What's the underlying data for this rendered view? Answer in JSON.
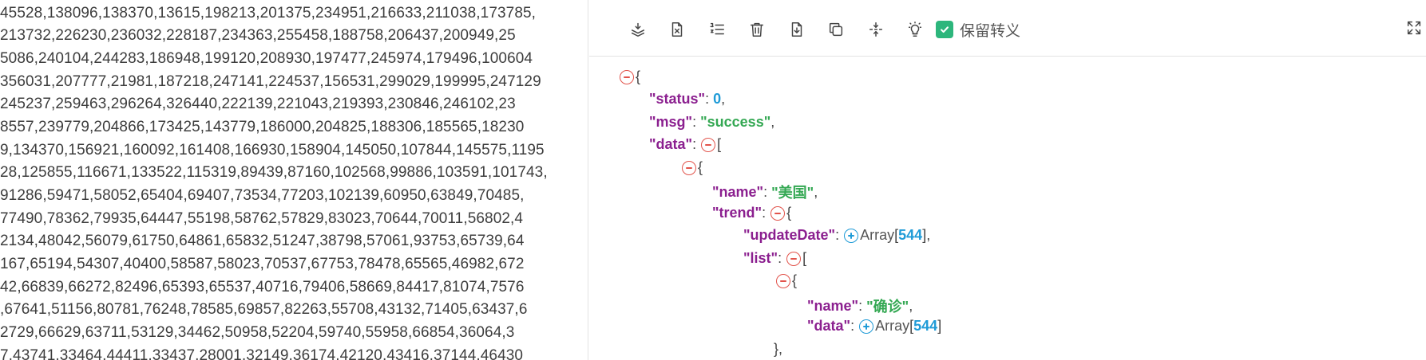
{
  "raw_text_lines": [
    "45528,138096,138370,13615,198213,201375,234951,216633,211038,173785,",
    "213732,226230,236032,228187,234363,255458,188758,206437,200949,25",
    "5086,240104,244283,186948,199120,208930,197477,245974,179496,100604",
    "356031,207777,21981,187218,247141,224537,156531,299029,199995,247129",
    "245237,259463,296264,326440,222139,221043,219393,230846,246102,23",
    "8557,239779,204866,173425,143779,186000,204825,188306,185565,18230",
    "9,134370,156921,160092,161408,166930,158904,145050,107844,145575,1195",
    "28,125855,116671,133522,115319,89439,87160,102568,99886,103591,101743,",
    "91286,59471,58052,65404,69407,73534,77203,102139,60950,63849,70485,",
    "77490,78362,79935,64447,55198,58762,57829,83023,70644,70011,56802,4",
    "2134,48042,56079,61750,64861,65832,51247,38798,57061,93753,65739,64",
    "167,65194,54307,40400,58587,58023,70537,67753,78478,65565,46982,672",
    "42,66839,66272,82496,65393,65537,40716,79406,58669,84417,81074,7576",
    ",67641,51156,80781,76248,78585,69857,82263,55708,43132,71405,63437,6",
    "2729,66629,63711,53129,34462,50958,52204,59740,55958,66854,36064,3",
    "7,43741,33464,44411,33437,28001,32149,36174,42120,43416,37144,46430"
  ],
  "toolbar": {
    "icons": [
      "collapse-all-icon",
      "clear-file-icon",
      "format-list-icon",
      "delete-icon",
      "download-icon",
      "copy-icon",
      "compress-icon",
      "lightbulb-icon"
    ],
    "keep_escape_label": "保留转义",
    "keep_escape_checked": true,
    "accent": "#2db67c"
  },
  "json_tree": {
    "open_brace": "{",
    "open_bracket": "[",
    "array_word": "Array",
    "status_key": "\"status\"",
    "status_value": "0",
    "msg_key": "\"msg\"",
    "msg_value": "\"success\"",
    "data_key": "\"data\"",
    "name_key": "\"name\"",
    "name_value": "\"美国\"",
    "trend_key": "\"trend\"",
    "update_date_key": "\"updateDate\"",
    "update_date_count": "544",
    "list_key": "\"list\"",
    "item_name_key": "\"name\"",
    "item_name_value": "\"确诊\"",
    "item_data_key": "\"data\"",
    "item_data_count": "544",
    "close_obj": "},"
  },
  "colors": {
    "key": "#8b1f8f",
    "number": "#1f9bd7",
    "string": "#34a853",
    "collapse_toggle": "#e2534b",
    "expand_toggle": "#1f9bd7"
  }
}
